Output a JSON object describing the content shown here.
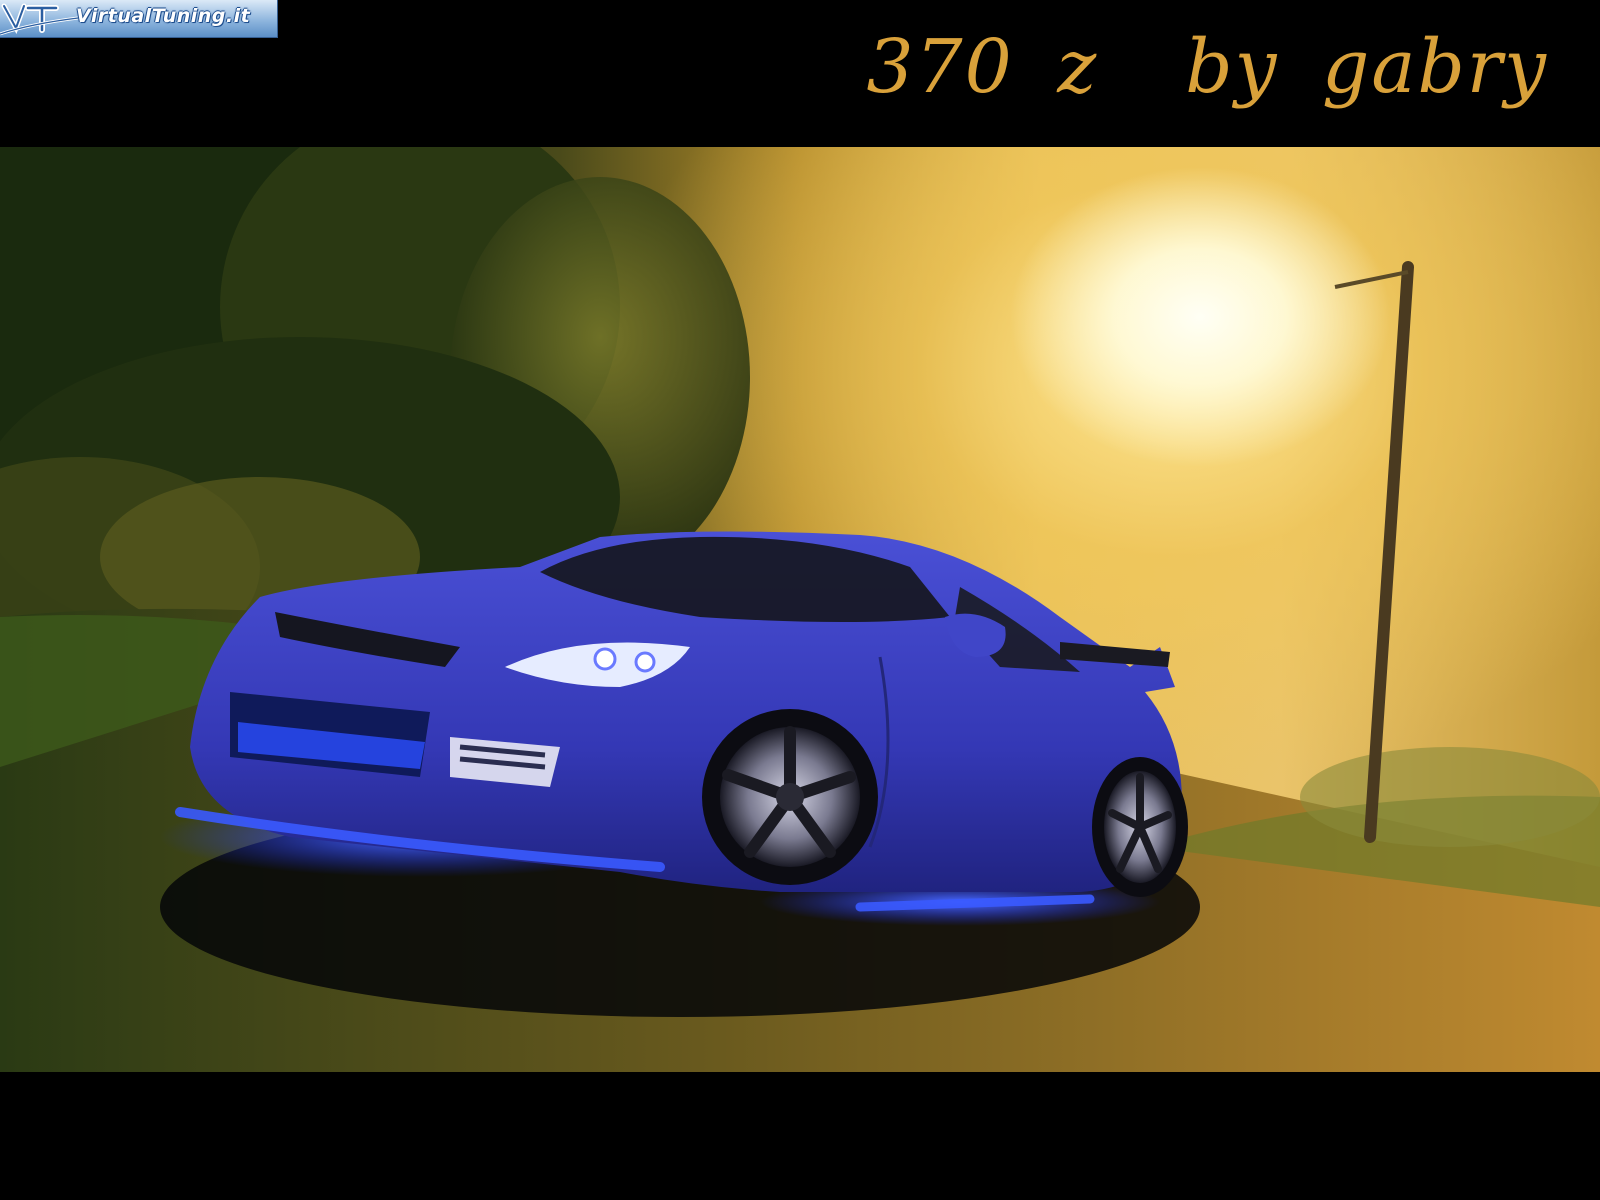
{
  "watermark": {
    "logo_text": "VirtualTuning.it"
  },
  "title": {
    "text": "370 z  by gabry",
    "color": "#d9a13a"
  },
  "scene": {
    "car_color": "#3a3fc0",
    "underglow_color": "#2a4dff",
    "light_color": "#fff3c0"
  }
}
